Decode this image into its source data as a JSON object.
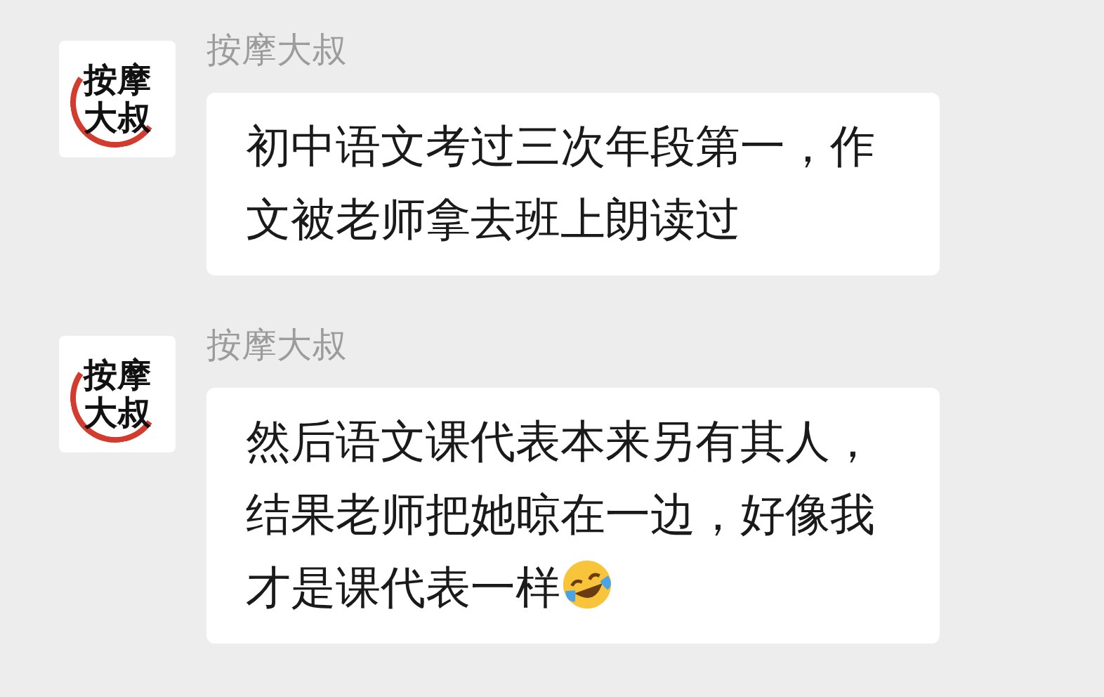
{
  "messages": [
    {
      "sender": "按摩大叔",
      "avatar_text": "按摩大叔",
      "text": "初中语文考过三次年段第一，作文被老师拿去班上朗读过",
      "trailing_emoji": false
    },
    {
      "sender": "按摩大叔",
      "avatar_text": "按摩大叔",
      "text": "然后语文课代表本来另有其人，结果老师把她晾在一边，好像我才是课代表一样",
      "trailing_emoji": true
    }
  ]
}
